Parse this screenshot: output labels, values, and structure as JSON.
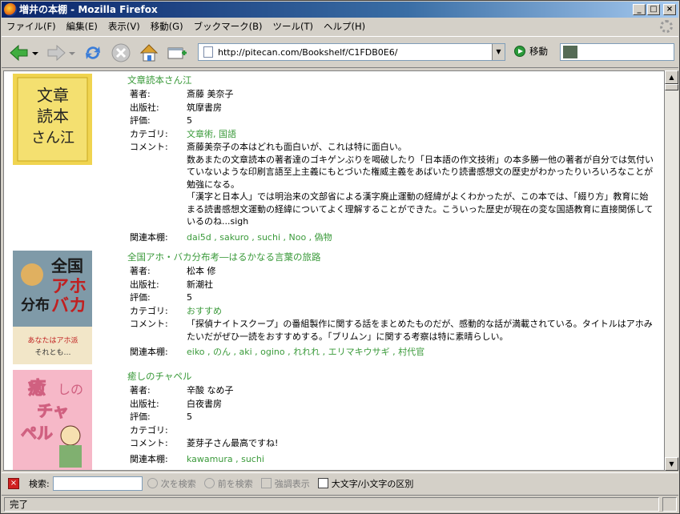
{
  "window": {
    "title": "増井の本棚 - Mozilla Firefox"
  },
  "menu": [
    "ファイル(F)",
    "編集(E)",
    "表示(V)",
    "移動(G)",
    "ブックマーク(B)",
    "ツール(T)",
    "ヘルプ(H)"
  ],
  "nav": {
    "url": "http://pitecan.com/Bookshelf/C1FDB0E6/",
    "go_label": "移動"
  },
  "labels": {
    "author": "著者:",
    "publisher": "出版社:",
    "rating": "評価:",
    "category": "カテゴリ:",
    "comment": "コメント:",
    "related": "関連本棚:"
  },
  "books": [
    {
      "title": "文章読本さん江",
      "author": "斎藤 美奈子",
      "publisher": "筑摩書房",
      "rating": "5",
      "category": "文章術, 国語",
      "comment": [
        "斎藤美奈子の本はどれも面白いが、これは特に面白い。",
        "数あまたの文章読本の著者達のゴキゲンぶりを喝破したり「日本語の作文技術」の本多勝一他の著者が自分では気付いていないような印刷言語至上主義にもとづいた権威主義をあばいたり読書感想文の歴史がわかったりいろいろなことが勉強になる。",
        "「漢字と日本人」では明治来の文部省による漢字廃止運動の経緯がよくわかったが、この本では、「綴り方」教育に始まる読書感想文運動の経緯についてよく理解することができた。こういった歴史が現在の変な国語教育に直接関係しているのね...sigh"
      ],
      "related": "dai5d , sakuro , suchi , Noo , 偽物",
      "cover_text": "文章読本さん江"
    },
    {
      "title": "全国アホ・バカ分布考―はるかなる言葉の旅路",
      "author": "松本 修",
      "publisher": "新潮社",
      "rating": "5",
      "category": "おすすめ",
      "comment": [
        "「探偵ナイトスクープ」の番組製作に関する話をまとめたものだが、感動的な話が満載されている。タイトルはアホみたいだがぜひ一読をおすすめする。「ブリムン」に関する考察は特に素晴らしい。"
      ],
      "related": "eiko , のん , aki , ogino , れれれ , エリマキウサギ , 村代官",
      "cover_text": "全国アホバカ分布考"
    },
    {
      "title": "癒しのチャペル",
      "author": "辛酸 なめ子",
      "publisher": "白夜書房",
      "rating": "5",
      "category": "",
      "comment": [
        "菱芽子さん最高ですね!"
      ],
      "related": "kawamura , suchi",
      "cover_text": "癒しのチャペル"
    }
  ],
  "findbar": {
    "label": "検索:",
    "next": "次を検索",
    "prev": "前を検索",
    "highlight": "強調表示",
    "match_case": "大文字/小文字の区別"
  },
  "status": {
    "text": "完了"
  },
  "colors": {
    "link": "#3a9a3a",
    "titlebar": "#0a246a"
  }
}
